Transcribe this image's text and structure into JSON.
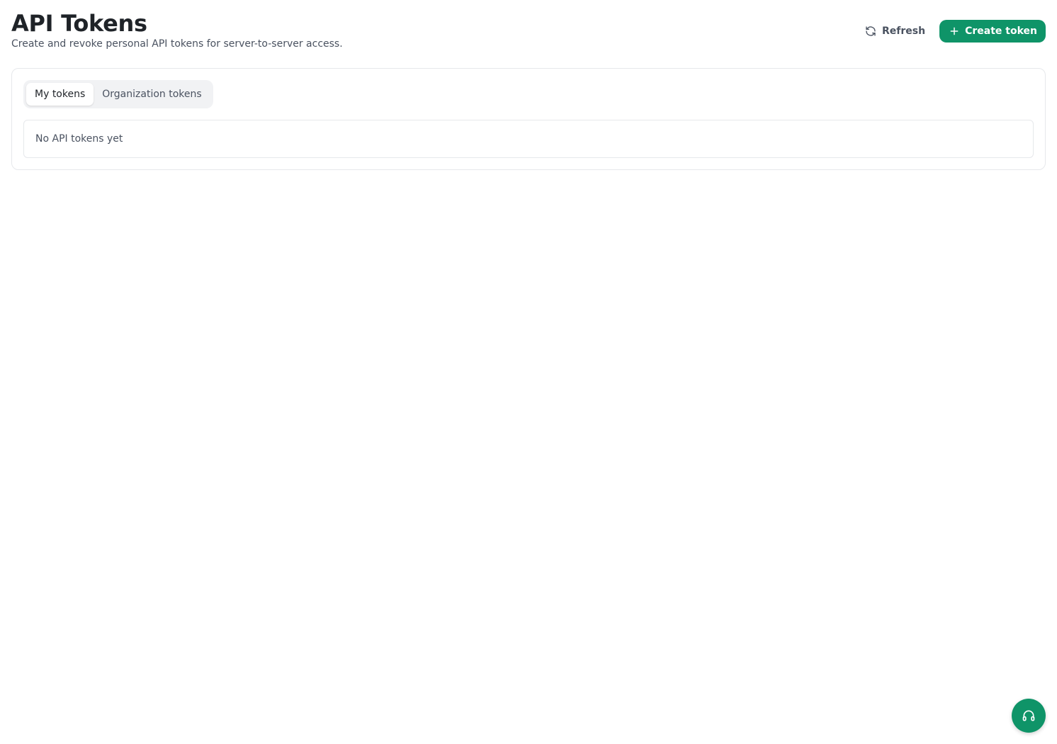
{
  "header": {
    "title": "API Tokens",
    "subtitle": "Create and revoke personal API tokens for server-to-server access."
  },
  "actions": {
    "refresh_label": "Refresh",
    "refresh_icon": "refresh-icon",
    "create_label": "Create token",
    "create_icon": "plus-icon"
  },
  "tabs": [
    {
      "label": "My tokens",
      "active": true
    },
    {
      "label": "Organization tokens",
      "active": false
    }
  ],
  "tokens": {
    "empty_message": "No API tokens yet"
  },
  "support": {
    "icon": "headset-icon"
  },
  "colors": {
    "accent": "#0f9468",
    "text_primary": "#1f2328",
    "text_secondary": "#4a5260",
    "border": "#e6e8eb",
    "tab_track": "#f1f2f4"
  }
}
